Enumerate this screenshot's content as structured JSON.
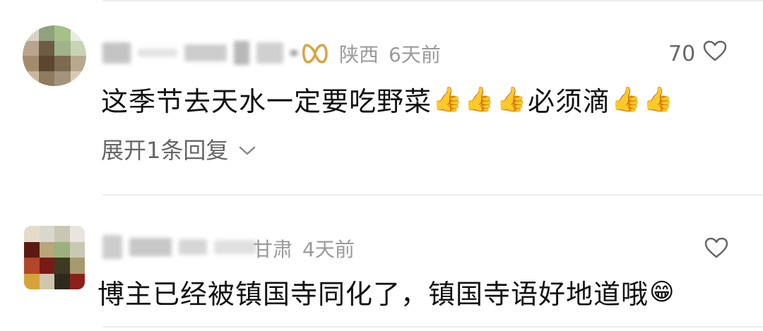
{
  "comments": [
    {
      "location": "陕西",
      "time": "6天前",
      "likes": "70",
      "text": "这季节去天水一定要吃野菜",
      "text_tail": "必须滴",
      "expand_replies": "展开1条回复"
    },
    {
      "location": "甘肃",
      "time": "4天前",
      "likes": "",
      "text": "博主已经被镇国寺同化了，镇国寺语好地道哦"
    }
  ],
  "emoji": {
    "thumbs_up": "👍",
    "grin": "😁"
  },
  "colors": {
    "meta_gray": "#9a9a9a",
    "badge_gold": "#d9a441",
    "divider": "#eeeeee"
  }
}
